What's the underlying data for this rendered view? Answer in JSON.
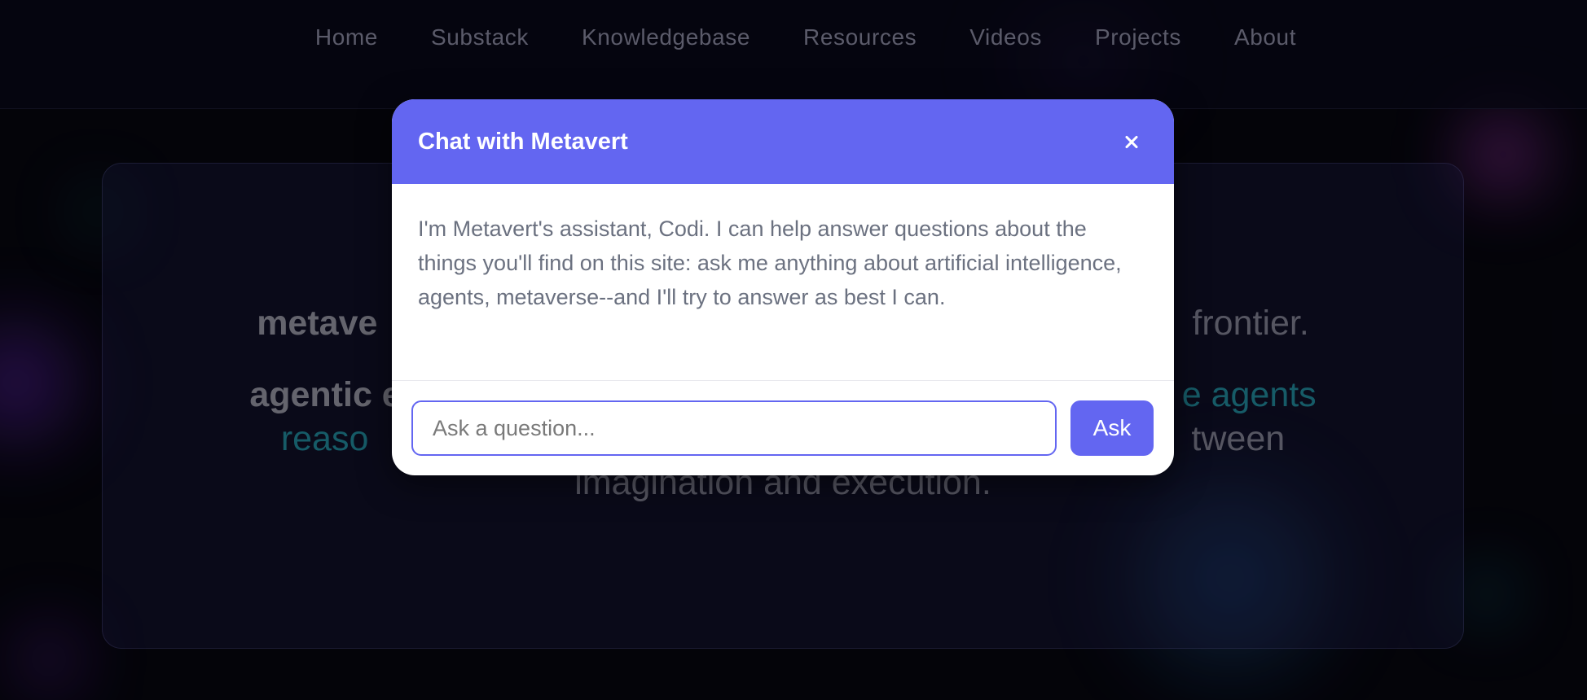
{
  "nav": {
    "items": [
      "Home",
      "Substack",
      "Knowledgebase",
      "Resources",
      "Videos",
      "Projects",
      "About"
    ]
  },
  "hero": {
    "line1_left": "metave",
    "line1_right": "frontier.",
    "line2_left": "agentic e",
    "line2_right": "e agents",
    "line3_left": "reaso",
    "line3_right": "tween",
    "line4": "imagination and execution."
  },
  "chat": {
    "title": "Chat with Metavert",
    "message": "I'm Metavert's assistant, Codi. I can help answer questions about the things you'll find on this site: ask me anything about artificial intelligence, agents, metaverse--and I'll try to answer as best I can.",
    "input_placeholder": "Ask a question...",
    "ask_label": "Ask"
  },
  "colors": {
    "accent": "#6366f1",
    "teal_text": "#1b6f7e",
    "background": "#05050c"
  },
  "icons": {
    "close": "close-icon"
  }
}
